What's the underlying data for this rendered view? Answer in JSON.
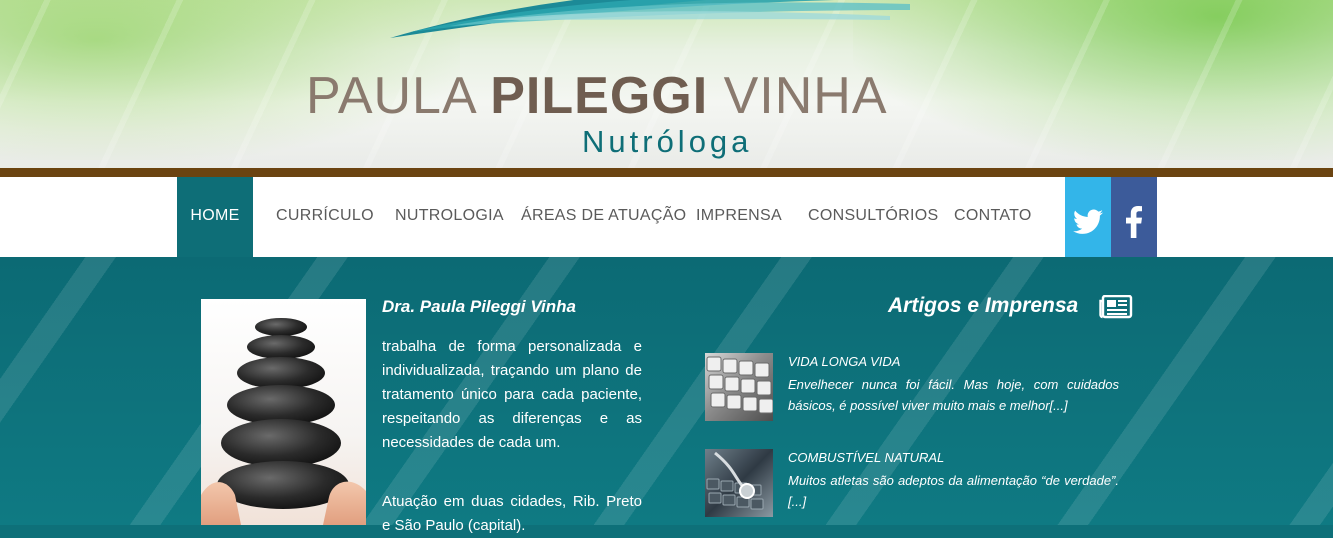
{
  "header": {
    "logo_name_light_1": "PAULA",
    "logo_name_bold": "PILEGGI",
    "logo_name_light_2": "VINHA",
    "logo_subtitle": "Nutróloga"
  },
  "nav": {
    "items": [
      {
        "label": "HOME",
        "active": true
      },
      {
        "label": "CURRÍCULO"
      },
      {
        "label": "NUTROLOGIA"
      },
      {
        "label": "ÁREAS DE ATUAÇÃO"
      },
      {
        "label": "IMPRENSA"
      },
      {
        "label": "CONSULTÓRIOS"
      },
      {
        "label": "CONTATO"
      }
    ],
    "social": [
      {
        "icon": "twitter-icon",
        "color": "#33b5e9"
      },
      {
        "icon": "facebook-icon",
        "color": "#3c5b9a"
      }
    ]
  },
  "intro": {
    "title": "Dra. Paula Pileggi Vinha",
    "paragraph_1": "trabalha de forma personalizada e individualizada, traçando um plano de tratamento único para cada paciente, respeitando as diferenças e as necessidades de cada um.",
    "paragraph_2": "Atuação em duas cidades, Rib. Preto e São Paulo (capital)."
  },
  "articles": {
    "heading": "Artigos e Imprensa",
    "icon": "newspaper-icon",
    "items": [
      {
        "title": "VIDA LONGA VIDA",
        "excerpt": "Envelhecer nunca foi fácil. Mas hoje, com cuidados básicos, é possível viver muito mais e melhor[...]"
      },
      {
        "title": "COMBUSTÍVEL NATURAL",
        "excerpt": "Muitos atletas são adeptos da alimentação “de verdade”. [...]"
      }
    ]
  },
  "colors": {
    "teal": "#0e6e77",
    "brown_bar": "#6b4411",
    "twitter": "#33b5e9",
    "facebook": "#3c5b9a"
  }
}
